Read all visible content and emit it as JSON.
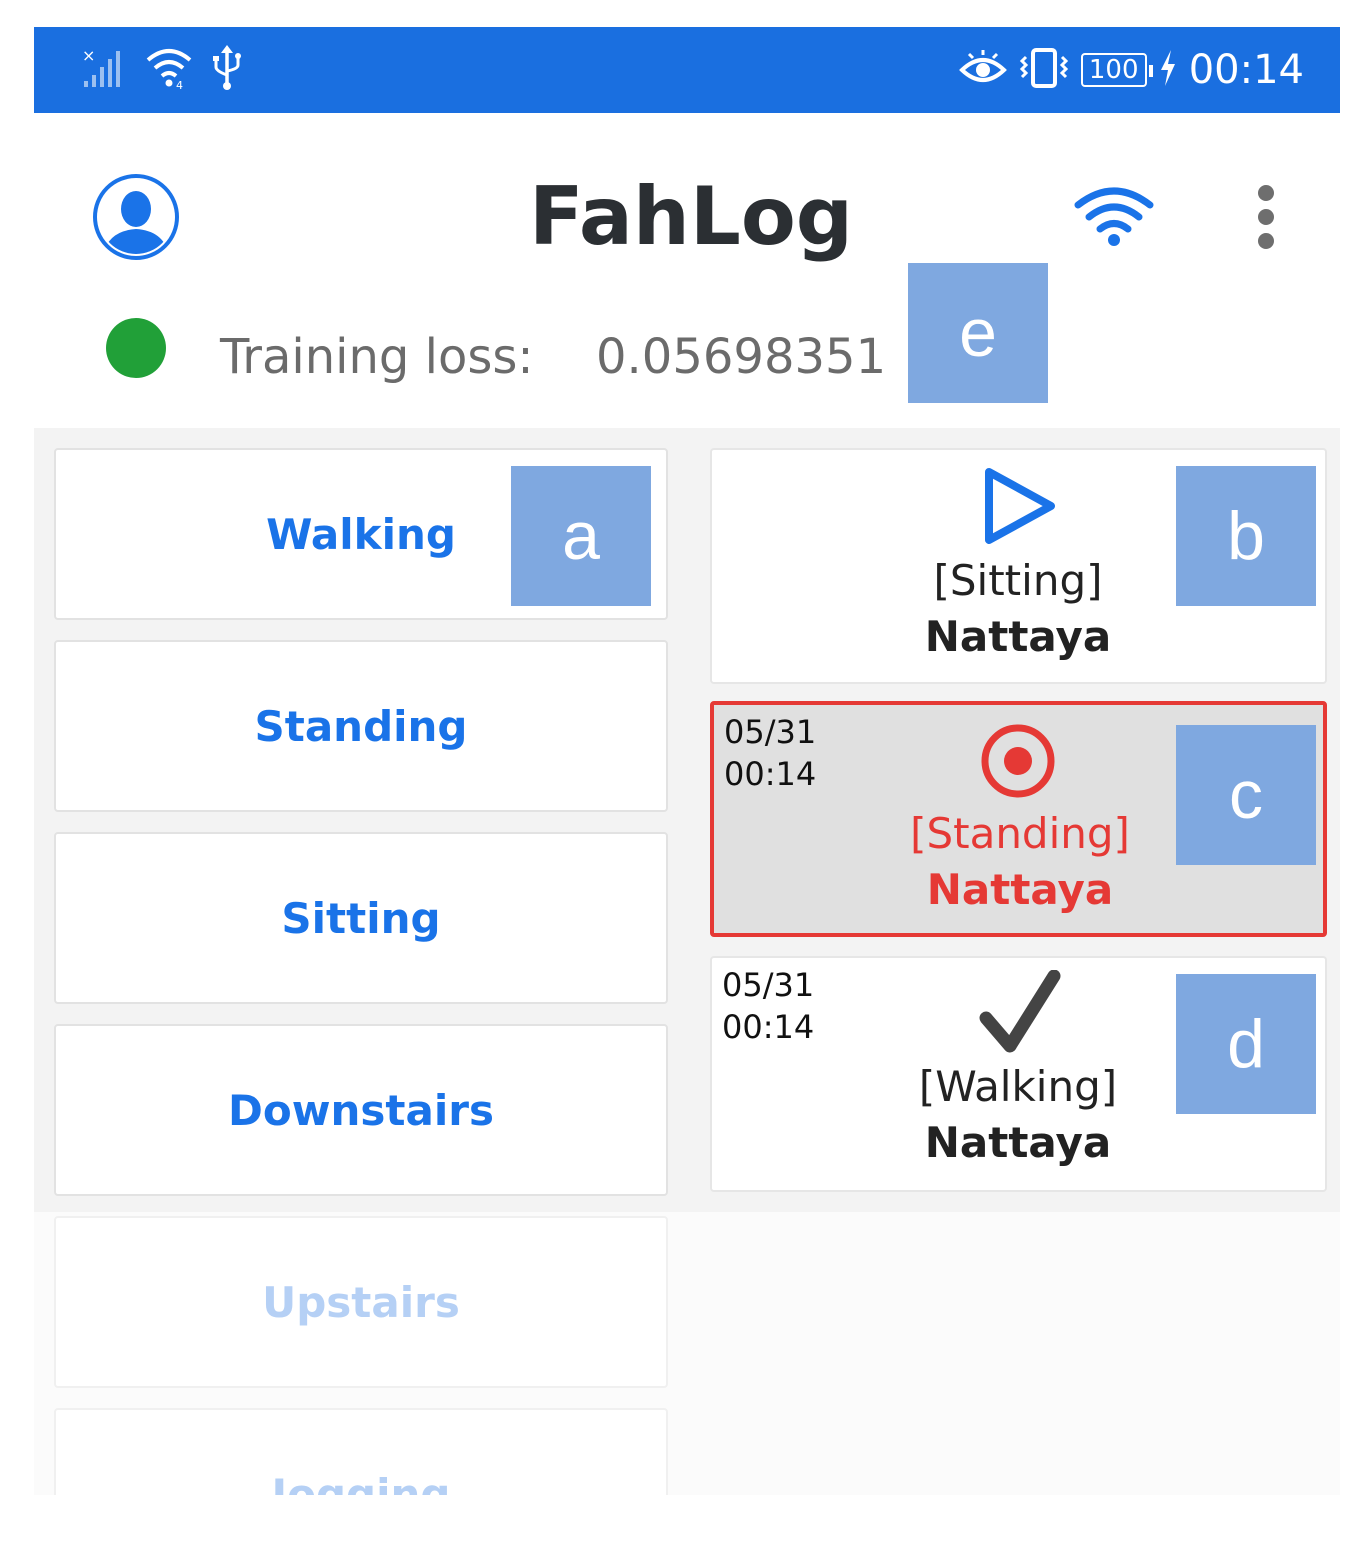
{
  "status_bar": {
    "time": "00:14",
    "battery": "100",
    "icons": [
      "no-sim-signal-icon",
      "wifi-4g-icon",
      "usb-icon",
      "eye-comfort-icon",
      "vibrate-icon",
      "battery-icon",
      "charging-icon"
    ],
    "background_color": "#1a6fe0"
  },
  "header": {
    "title": "FahLog",
    "icons": [
      "avatar-icon",
      "wifi-icon",
      "more-vert-icon"
    ]
  },
  "training": {
    "label": "Training loss:",
    "value": "0.05698351",
    "status_color": "#21a038"
  },
  "markers": {
    "a": "a",
    "b": "b",
    "c": "c",
    "d": "d",
    "e": "e"
  },
  "activities": [
    "Walking",
    "Standing",
    "Sitting",
    "Downstairs",
    "Upstairs",
    "Jogging"
  ],
  "log_cards": [
    {
      "date": "",
      "time": "",
      "activity": "[Sitting]",
      "user": "Nattaya",
      "state": "pending",
      "icon": "play-outline-icon"
    },
    {
      "date": "05/31",
      "time": "00:14",
      "activity": "[Standing]",
      "user": "Nattaya",
      "state": "recording",
      "icon": "record-icon"
    },
    {
      "date": "05/31",
      "time": "00:14",
      "activity": "[Walking]",
      "user": "Nattaya",
      "state": "done",
      "icon": "checkmark-icon"
    }
  ],
  "colors": {
    "accent": "#1a73e8",
    "recording": "#e53935",
    "marker": "#7fa8e0"
  }
}
